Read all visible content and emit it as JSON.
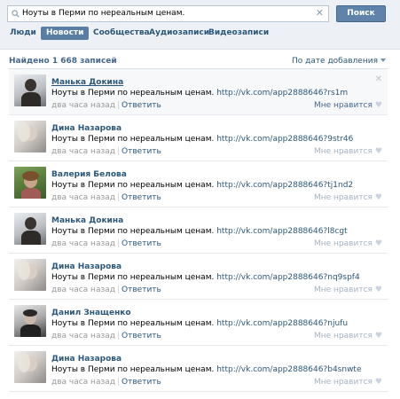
{
  "search": {
    "query": "Ноуты в Перми по нереальным ценам.",
    "button_label": "Поиск",
    "clear_glyph": "✕"
  },
  "tabs": [
    {
      "label": "Люди",
      "active": false
    },
    {
      "label": "Новости",
      "active": true
    },
    {
      "label": "Сообщества",
      "active": false
    },
    {
      "label": "Аудиозаписи",
      "active": false
    },
    {
      "label": "Видеозаписи",
      "active": false
    }
  ],
  "summary": {
    "found": "Найдено 1 668 записей",
    "sort_label": "По дате добавления"
  },
  "posts": [
    {
      "author": "Манька Докина",
      "text": "Ноуты в Перми по нереальным ценам.",
      "link": "http://vk.com/app2888646?rs1m",
      "time": "два часа назад",
      "reply": "Ответить",
      "like": "Мне нравится"
    },
    {
      "author": "Дина Назарова",
      "text": "Ноуты в Перми по нереальным ценам.",
      "link": "http://vk.com/app2888646?9str46",
      "time": "два часа назад",
      "reply": "Ответить",
      "like": "Мне нравится"
    },
    {
      "author": "Валерия Белова",
      "text": "Ноуты в Перми по нереальным ценам.",
      "link": "http://vk.com/app2888646?tj1nd2",
      "time": "два часа назад",
      "reply": "Ответить",
      "like": "Мне нравится"
    },
    {
      "author": "Манька Докина",
      "text": "Ноуты в Перми по нереальным ценам.",
      "link": "http://vk.com/app2888646?l8cgt",
      "time": "два часа назад",
      "reply": "Ответить",
      "like": "Мне нравится"
    },
    {
      "author": "Дина Назарова",
      "text": "Ноуты в Перми по нереальным ценам.",
      "link": "http://vk.com/app2888646?nq9spf4",
      "time": "два часа назад",
      "reply": "Ответить",
      "like": "Мне нравится"
    },
    {
      "author": "Данил Знащенко",
      "text": "Ноуты в Перми по нереальным ценам.",
      "link": "http://vk.com/app2888646?njufu",
      "time": "два часа назад",
      "reply": "Ответить",
      "like": "Мне нравится"
    },
    {
      "author": "Дина Назарова",
      "text": "Ноуты в Перми по нереальным ценам.",
      "link": "http://vk.com/app2888646?b4snwte",
      "time": "два часа назад",
      "reply": "Ответить",
      "like": "Мне нравится"
    }
  ],
  "colors": {
    "accent": "#597da3",
    "link": "#2b587a",
    "muted": "#999999"
  },
  "icons": {
    "search": "search-icon",
    "clear": "close-icon",
    "sort": "chevron-down-icon",
    "like": "heart-icon",
    "dismiss": "close-icon"
  }
}
